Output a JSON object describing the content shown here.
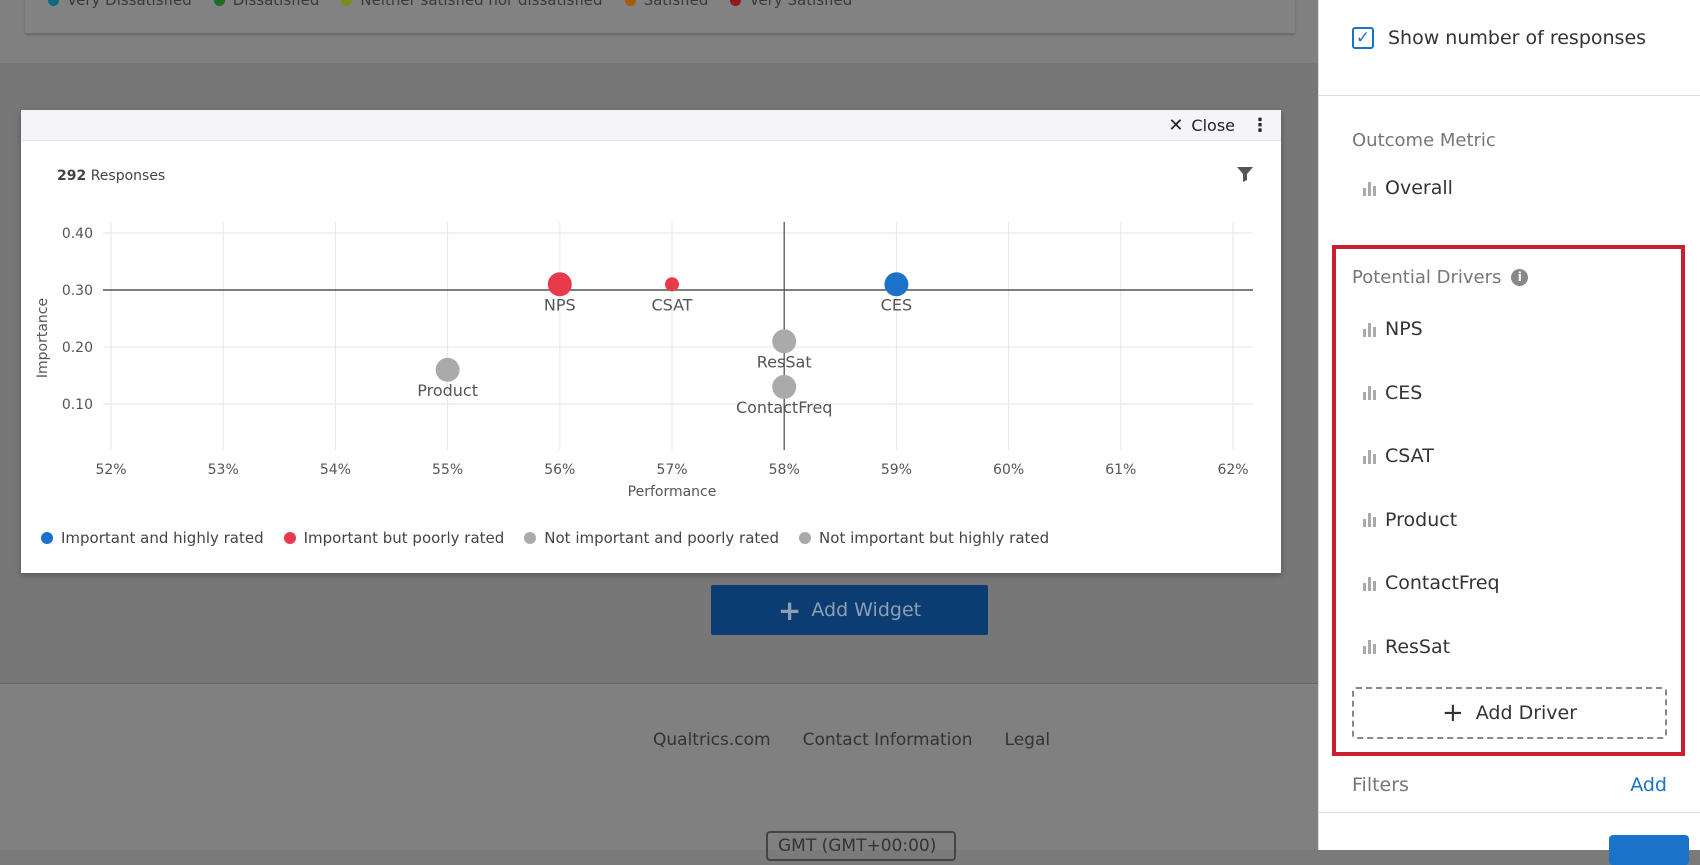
{
  "background": {
    "legend": [
      {
        "label": "Very Dissatisfied",
        "color": "#0e6a7a"
      },
      {
        "label": "Dissatisfied",
        "color": "#1f6b2a"
      },
      {
        "label": "Neither satisfied nor dissatisfied",
        "color": "#7a8a1f"
      },
      {
        "label": "Satisfied",
        "color": "#a8590e"
      },
      {
        "label": "Very Satisfied",
        "color": "#8e1a1a"
      }
    ],
    "add_widget": "Add Widget",
    "footer_links": [
      "Qualtrics.com",
      "Contact Information",
      "Legal"
    ],
    "timezone": "GMT (GMT+00:00)"
  },
  "modal": {
    "close_label": "Close",
    "responses_count": "292",
    "responses_label": "Responses",
    "legend": [
      {
        "label": "Important and highly rated",
        "color": "#1a73c8"
      },
      {
        "label": "Important but poorly rated",
        "color": "#e8394d"
      },
      {
        "label": "Not important and poorly rated",
        "color": "#aaaaaa"
      },
      {
        "label": "Not important but highly rated",
        "color": "#aaaaaa"
      }
    ]
  },
  "chart_data": {
    "type": "scatter",
    "xlabel": "Performance",
    "ylabel": "Importance",
    "xlim": [
      52,
      62
    ],
    "ylim": [
      0.06,
      0.44
    ],
    "x_ticks": [
      "52%",
      "53%",
      "54%",
      "55%",
      "56%",
      "57%",
      "58%",
      "59%",
      "60%",
      "61%",
      "62%"
    ],
    "y_ticks": [
      {
        "v": 0.1,
        "label": "0.10"
      },
      {
        "v": 0.2,
        "label": "0.20"
      },
      {
        "v": 0.3,
        "label": "0.30"
      },
      {
        "v": 0.4,
        "label": "0.40"
      }
    ],
    "reference_x": 58,
    "reference_y": 0.3,
    "points": [
      {
        "label": "NPS",
        "x": 56,
        "y": 0.31,
        "color": "#e8394d",
        "size": "large"
      },
      {
        "label": "CSAT",
        "x": 57,
        "y": 0.31,
        "color": "#e8394d",
        "size": "small"
      },
      {
        "label": "CES",
        "x": 59,
        "y": 0.31,
        "color": "#1a73c8",
        "size": "large"
      },
      {
        "label": "ResSat",
        "x": 58,
        "y": 0.21,
        "color": "#aaaaaa",
        "size": "large"
      },
      {
        "label": "ContactFreq",
        "x": 58,
        "y": 0.13,
        "color": "#aaaaaa",
        "size": "large"
      },
      {
        "label": "Product",
        "x": 55,
        "y": 0.16,
        "color": "#aaaaaa",
        "size": "large"
      }
    ]
  },
  "sidebar": {
    "show_responses": "Show number of responses",
    "outcome_title": "Outcome Metric",
    "outcome": "Overall",
    "drivers_title": "Potential Drivers",
    "drivers": [
      "NPS",
      "CES",
      "CSAT",
      "Product",
      "ContactFreq",
      "ResSat"
    ],
    "add_driver": "Add Driver",
    "filters": "Filters",
    "filters_add": "Add"
  }
}
